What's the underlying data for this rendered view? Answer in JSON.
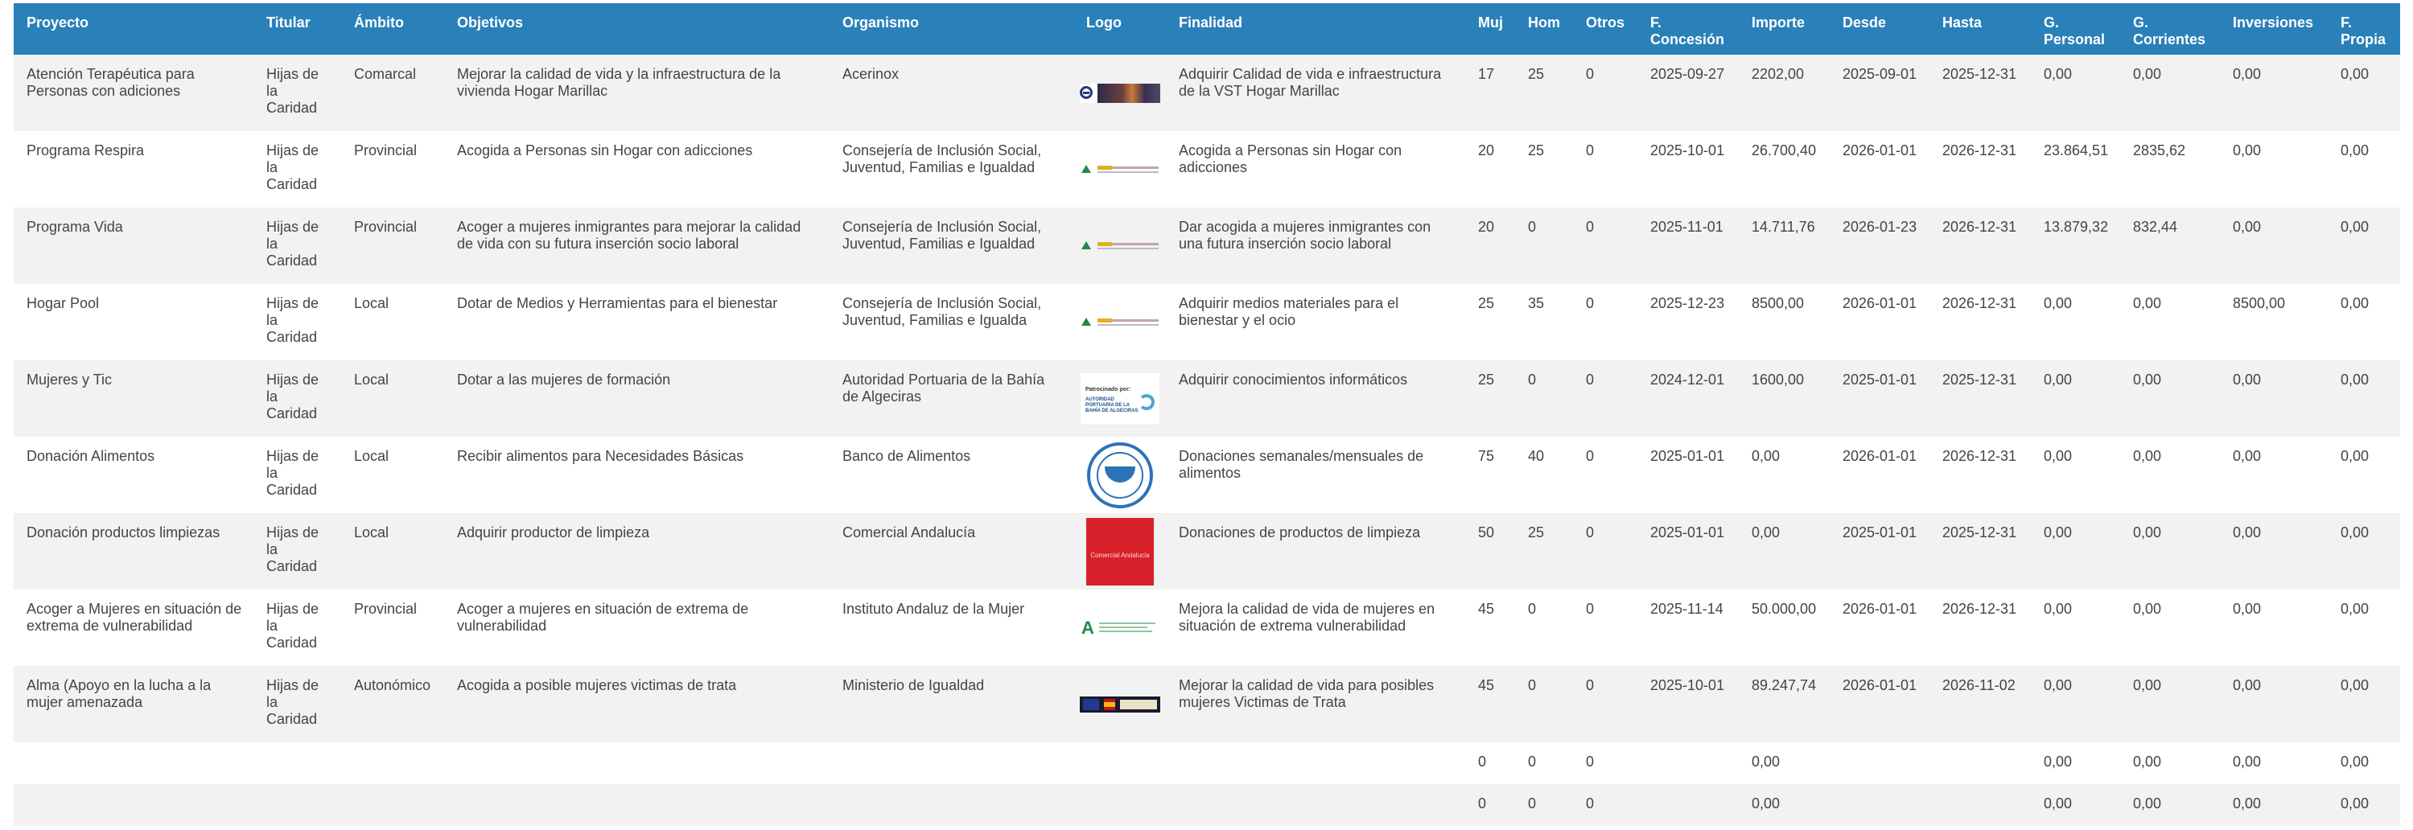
{
  "headers": [
    "Proyecto",
    "Titular",
    "Ámbito",
    "Objetivos",
    "Organismo",
    "Logo",
    "Finalidad",
    "Muj",
    "Hom",
    "Otros",
    "F. Concesión",
    "Importe",
    "Desde",
    "Hasta",
    "G. Personal",
    "G. Corrientes",
    "Inversiones",
    "F. Propia"
  ],
  "rows": [
    {
      "proyecto": "Atención Terapéutica para Personas con adiciones",
      "titular": "Hijas de la Caridad",
      "ambito": "Comarcal",
      "objetivos": "Mejorar la calidad de vida y la infraestructura de la vivienda Hogar Marillac",
      "organismo": "Acerinox",
      "logo": "acerinox-logo",
      "finalidad": "Adquirir Calidad de vida e infraestructura de la VST Hogar Marillac",
      "muj": "17",
      "hom": "25",
      "otros": "0",
      "concesion": "2025-09-27",
      "importe": "2202,00",
      "desde": "2025-09-01",
      "hasta": "2025-12-31",
      "gpersonal": "0,00",
      "gcorrientes": "0,00",
      "inversiones": "0,00",
      "fpropia": "0,00"
    },
    {
      "proyecto": "Programa Respira",
      "titular": "Hijas de la Caridad",
      "ambito": "Provincial",
      "objetivos": "Acogida a Personas sin Hogar con adicciones",
      "organismo": "Consejería de Inclusión Social, Juventud, Familias e Igualdad",
      "logo": "junta-logo",
      "finalidad": "Acogida a Personas sin Hogar con adicciones",
      "muj": "20",
      "hom": "25",
      "otros": "0",
      "concesion": "2025-10-01",
      "importe": "26.700,40",
      "desde": "2026-01-01",
      "hasta": "2026-12-31",
      "gpersonal": "23.864,51",
      "gcorrientes": "2835,62",
      "inversiones": "0,00",
      "fpropia": "0,00"
    },
    {
      "proyecto": "Programa Vida",
      "titular": "Hijas de la Caridad",
      "ambito": "Provincial",
      "objetivos": "Acoger a mujeres inmigrantes para mejorar la calidad de vida con su futura inserción socio laboral",
      "organismo": "Consejería de Inclusión Social, Juventud, Familias e Igualdad",
      "logo": "junta-logo",
      "finalidad": "Dar acogida a mujeres inmigrantes con una futura inserción socio laboral",
      "muj": "20",
      "hom": "0",
      "otros": "0",
      "concesion": "2025-11-01",
      "importe": "14.711,76",
      "desde": "2026-01-23",
      "hasta": "2026-12-31",
      "gpersonal": "13.879,32",
      "gcorrientes": "832,44",
      "inversiones": "0,00",
      "fpropia": "0,00"
    },
    {
      "proyecto": "Hogar Pool",
      "titular": "Hijas de la Caridad",
      "ambito": "Local",
      "objetivos": "Dotar de Medios y Herramientas para el bienestar",
      "organismo": "Consejería de Inclusión Social, Juventud, Familias e Igualda",
      "logo": "junta-logo",
      "finalidad": "Adquirir medios materiales para el bienestar y el ocio",
      "muj": "25",
      "hom": "35",
      "otros": "0",
      "concesion": "2025-12-23",
      "importe": "8500,00",
      "desde": "2026-01-01",
      "hasta": "2026-12-31",
      "gpersonal": "0,00",
      "gcorrientes": "0,00",
      "inversiones": "8500,00",
      "fpropia": "0,00"
    },
    {
      "proyecto": "Mujeres y Tic",
      "titular": "Hijas de la Caridad",
      "ambito": "Local",
      "objetivos": "Dotar a las mujeres de formación",
      "organismo": "Autoridad Portuaria de la Bahía de Algeciras",
      "logo": "port-logo",
      "finalidad": "Adquirir conocimientos informáticos",
      "muj": "25",
      "hom": "0",
      "otros": "0",
      "concesion": "2024-12-01",
      "importe": "1600,00",
      "desde": "2025-01-01",
      "hasta": "2025-12-31",
      "gpersonal": "0,00",
      "gcorrientes": "0,00",
      "inversiones": "0,00",
      "fpropia": "0,00"
    },
    {
      "proyecto": "Donación Alimentos",
      "titular": "Hijas de la Caridad",
      "ambito": "Local",
      "objetivos": "Recibir alimentos para Necesidades Básicas",
      "organismo": "Banco de Alimentos",
      "logo": "banco-logo",
      "finalidad": "Donaciones semanales/mensuales de alimentos",
      "muj": "75",
      "hom": "40",
      "otros": "0",
      "concesion": "2025-01-01",
      "importe": "0,00",
      "desde": "2026-01-01",
      "hasta": "2026-12-31",
      "gpersonal": "0,00",
      "gcorrientes": "0,00",
      "inversiones": "0,00",
      "fpropia": "0,00"
    },
    {
      "proyecto": "Donación productos limpiezas",
      "titular": "Hijas de la Caridad",
      "ambito": "Local",
      "objetivos": "Adquirir productor de limpieza",
      "organismo": "Comercial Andalucía",
      "logo": "comercial-logo",
      "finalidad": "Donaciones de productos de limpieza",
      "muj": "50",
      "hom": "25",
      "otros": "0",
      "concesion": "2025-01-01",
      "importe": "0,00",
      "desde": "2025-01-01",
      "hasta": "2025-12-31",
      "gpersonal": "0,00",
      "gcorrientes": "0,00",
      "inversiones": "0,00",
      "fpropia": "0,00"
    },
    {
      "proyecto": "Acoger a Mujeres en situación de extrema de vulnerabilidad",
      "titular": "Hijas de la Caridad",
      "ambito": "Provincial",
      "objetivos": "Acoger a mujeres en situación de extrema de vulnerabilidad",
      "organismo": "Instituto Andaluz de la Mujer",
      "logo": "iam-logo",
      "finalidad": "Mejora la calidad de vida de mujeres en situación de extrema vulnerabilidad",
      "muj": "45",
      "hom": "0",
      "otros": "0",
      "concesion": "2025-11-14",
      "importe": "50.000,00",
      "desde": "2026-01-01",
      "hasta": "2026-12-31",
      "gpersonal": "0,00",
      "gcorrientes": "0,00",
      "inversiones": "0,00",
      "fpropia": "0,00"
    },
    {
      "proyecto": "Alma (Apoyo en la lucha a la mujer amenazada",
      "titular": "Hijas de la Caridad",
      "ambito": "Autonómico",
      "objetivos": "Acogida a posible mujeres victimas de trata",
      "organismo": "Ministerio de Igualdad",
      "logo": "ministerio-logo",
      "finalidad": "Mejorar la calidad de vida para posibles mujeres Victimas de Trata",
      "muj": "45",
      "hom": "0",
      "otros": "0",
      "concesion": "2025-10-01",
      "importe": "89.247,74",
      "desde": "2026-01-01",
      "hasta": "2026-11-02",
      "gpersonal": "0,00",
      "gcorrientes": "0,00",
      "inversiones": "0,00",
      "fpropia": "0,00"
    }
  ],
  "totals": [
    {
      "muj": "0",
      "hom": "0",
      "otros": "0",
      "importe": "0,00",
      "gpersonal": "0,00",
      "gcorrientes": "0,00",
      "inversiones": "0,00",
      "fpropia": "0,00"
    },
    {
      "muj": "0",
      "hom": "0",
      "otros": "0",
      "importe": "0,00",
      "gpersonal": "0,00",
      "gcorrientes": "0,00",
      "inversiones": "0,00",
      "fpropia": "0,00"
    }
  ],
  "logo_captions": {
    "port_top": "Patrocinado por:",
    "port_name": "AUTORIDAD PORTUARIA DE LA BAHÍA DE ALGECIRAS",
    "comercial": "Comercial Andalucía"
  }
}
